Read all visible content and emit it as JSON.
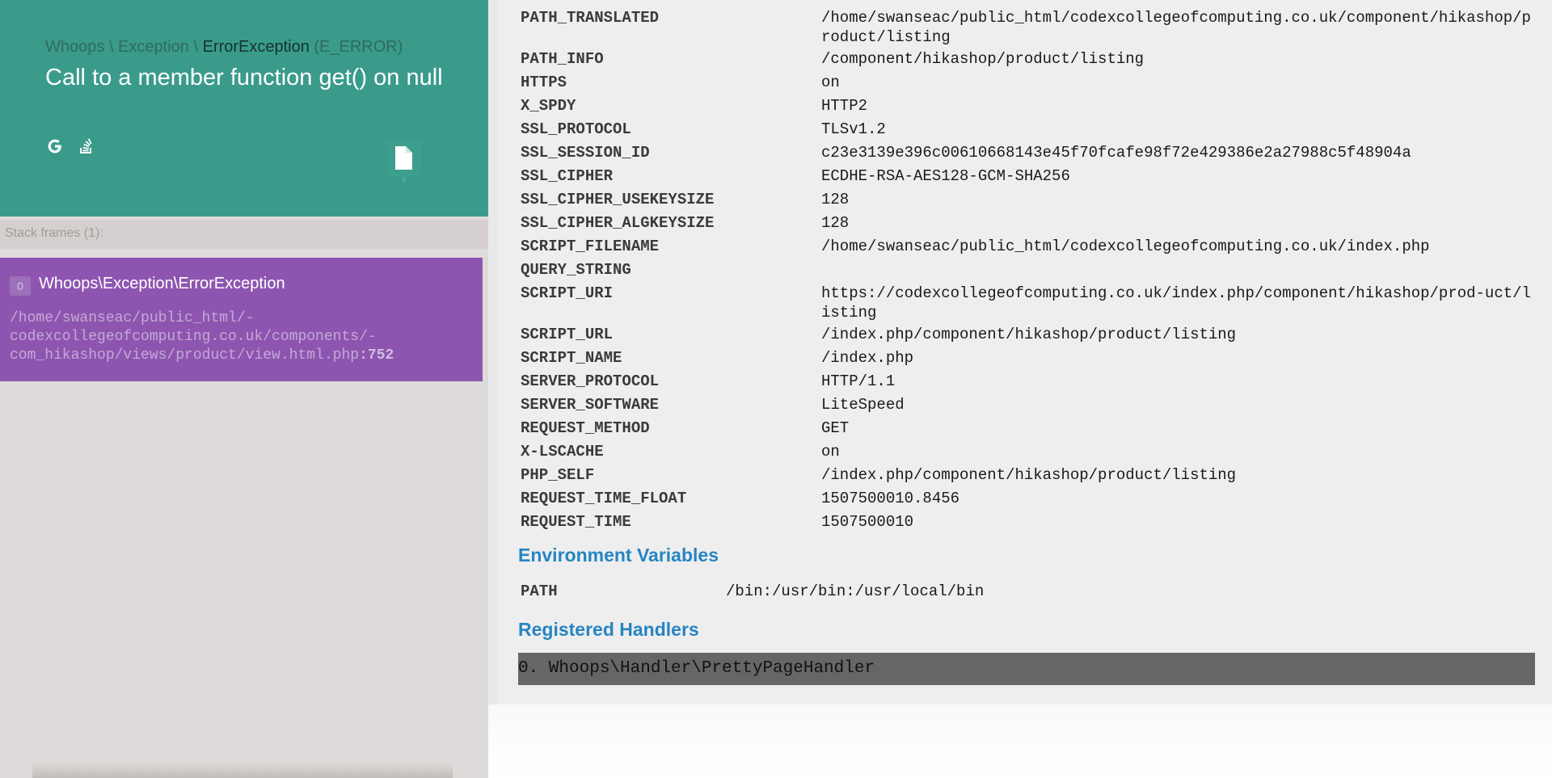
{
  "header": {
    "breadcrumb": [
      {
        "text": "Whoops \\ ",
        "strong": false
      },
      {
        "text": "Exception \\ ",
        "strong": false
      },
      {
        "text": "ErrorException",
        "strong": true
      },
      {
        "text": " (E_ERROR)",
        "strong": false
      }
    ],
    "message": "Call to a member function get() on null",
    "icons": [
      "google-search-icon",
      "stackoverflow-search-icon",
      "copy-icon"
    ]
  },
  "stack": {
    "label": "Stack frames (1):",
    "frames": [
      {
        "index": "0",
        "class": "Whoops\\Exception\\ErrorException",
        "file": "/home/swanseac/public_html/-\ncodexcollegeofcomputing.co.uk/components/-\ncom_hikashop/views/product/view.html.php",
        "line": ":752"
      }
    ]
  },
  "server_vars": [
    {
      "key": "PATH_TRANSLATED",
      "value": "/home/swanseac/public_html/codexcollegeofcomputing.co.uk/component/hikashop/product/listing"
    },
    {
      "key": "PATH_INFO",
      "value": "/component/hikashop/product/listing"
    },
    {
      "key": "HTTPS",
      "value": "on"
    },
    {
      "key": "X_SPDY",
      "value": "HTTP2"
    },
    {
      "key": "SSL_PROTOCOL",
      "value": "TLSv1.2"
    },
    {
      "key": "SSL_SESSION_ID",
      "value": "c23e3139e396c00610668143e45f70fcafe98f72e429386e2a27988c5f48904a"
    },
    {
      "key": "SSL_CIPHER",
      "value": "ECDHE-RSA-AES128-GCM-SHA256"
    },
    {
      "key": "SSL_CIPHER_USEKEYSIZE",
      "value": "128"
    },
    {
      "key": "SSL_CIPHER_ALGKEYSIZE",
      "value": "128"
    },
    {
      "key": "SCRIPT_FILENAME",
      "value": "/home/swanseac/public_html/codexcollegeofcomputing.co.uk/index.php"
    },
    {
      "key": "QUERY_STRING",
      "value": ""
    },
    {
      "key": "SCRIPT_URI",
      "value": "https://codexcollegeofcomputing.co.uk/index.php/component/hikashop/prod-uct/listing"
    },
    {
      "key": "SCRIPT_URL",
      "value": "/index.php/component/hikashop/product/listing"
    },
    {
      "key": "SCRIPT_NAME",
      "value": "/index.php"
    },
    {
      "key": "SERVER_PROTOCOL",
      "value": "HTTP/1.1"
    },
    {
      "key": "SERVER_SOFTWARE",
      "value": "LiteSpeed"
    },
    {
      "key": "REQUEST_METHOD",
      "value": "GET"
    },
    {
      "key": "X-LSCACHE",
      "value": "on"
    },
    {
      "key": "PHP_SELF",
      "value": "/index.php/component/hikashop/product/listing"
    },
    {
      "key": "REQUEST_TIME_FLOAT",
      "value": "1507500010.8456"
    },
    {
      "key": "REQUEST_TIME",
      "value": "1507500010"
    }
  ],
  "env": {
    "title": "Environment Variables",
    "vars": [
      {
        "key": "PATH",
        "value": "/bin:/usr/bin:/usr/local/bin"
      }
    ]
  },
  "handlers": {
    "title": "Registered Handlers",
    "items": [
      "0. Whoops\\Handler\\PrettyPageHandler"
    ]
  },
  "colors": {
    "header_bg": "#3a9b8b",
    "frame_bg": "#8e55b0",
    "section_title": "#2585c2",
    "handler_bg": "#666666"
  }
}
